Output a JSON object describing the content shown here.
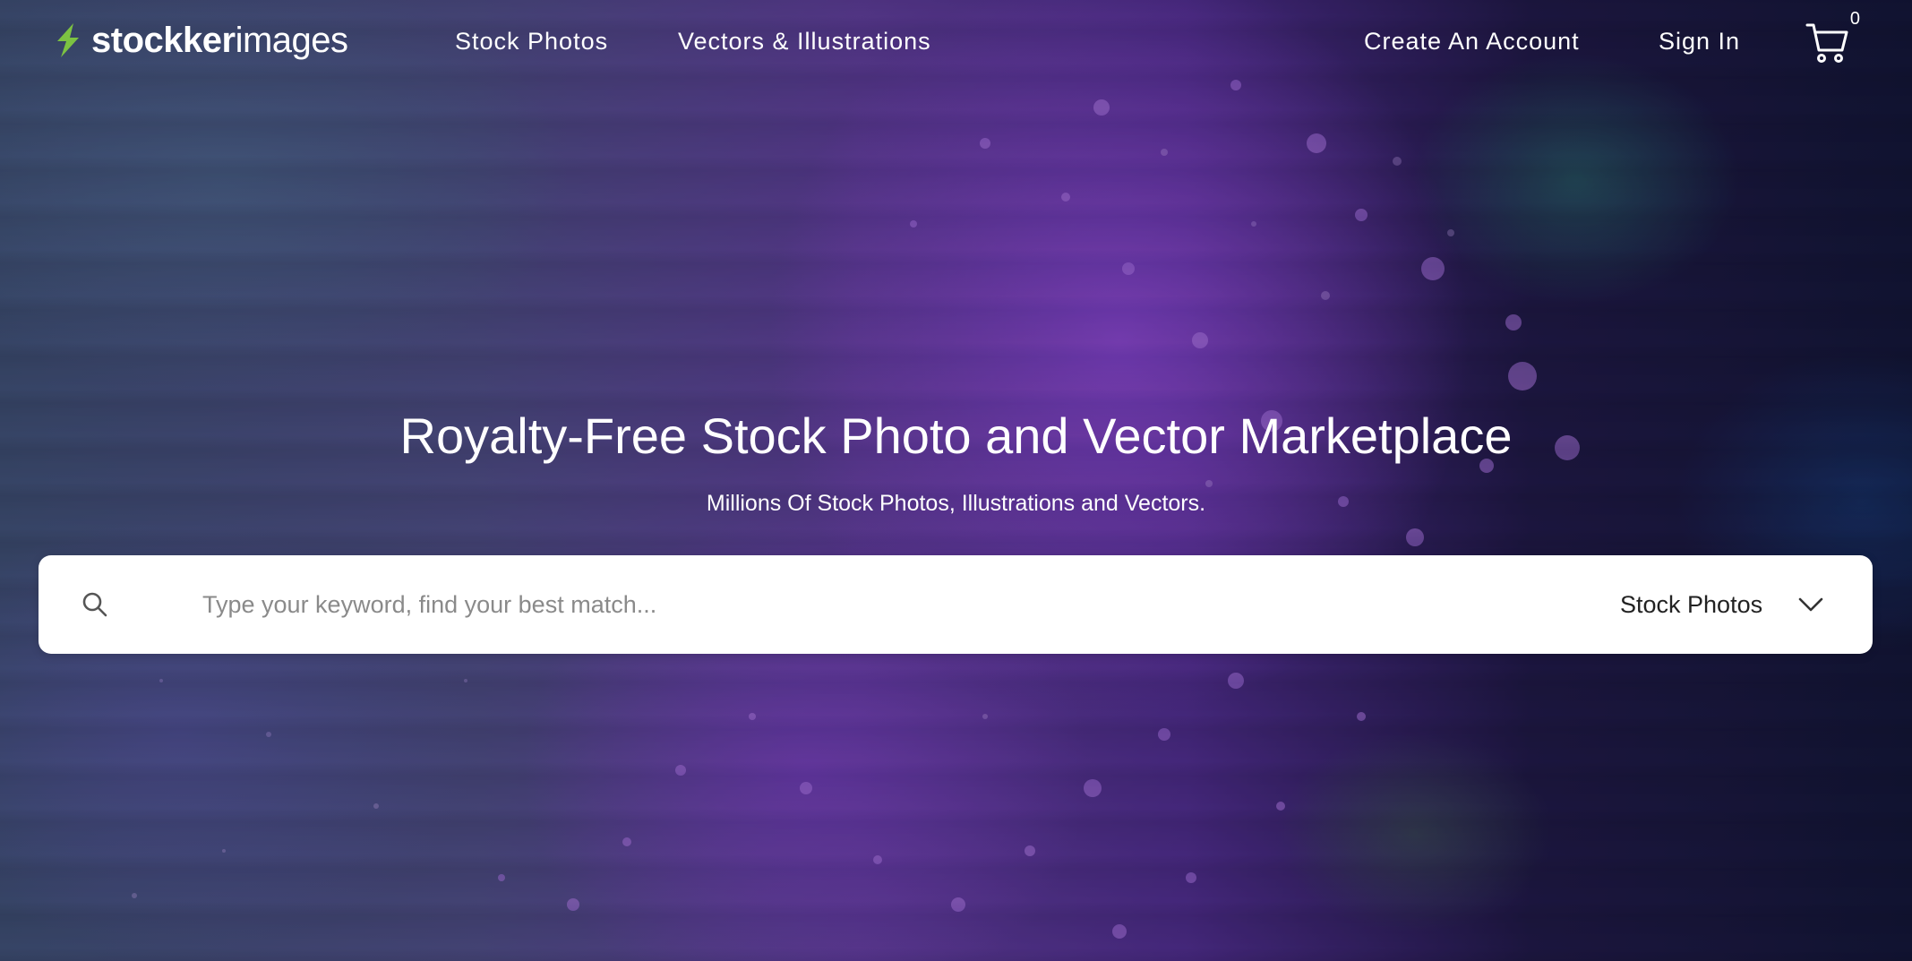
{
  "brand": {
    "name_bold": "stockker",
    "name_light": "images",
    "accent": "#7cc242"
  },
  "header": {
    "nav": {
      "stock_photos": "Stock Photos",
      "vectors": "Vectors & Illustrations",
      "create_account": "Create An Account",
      "sign_in": "Sign In"
    },
    "cart": {
      "icon": "cart-icon",
      "count": "0"
    }
  },
  "hero": {
    "title": "Royalty-Free Stock Photo and Vector Marketplace",
    "subtitle": "Millions Of Stock Photos, Illustrations and Vectors."
  },
  "search": {
    "icon": "search-icon",
    "placeholder": "Type your keyword, find your best match...",
    "value": "",
    "category": {
      "selected": "Stock Photos",
      "icon": "chevron-down-icon"
    }
  }
}
